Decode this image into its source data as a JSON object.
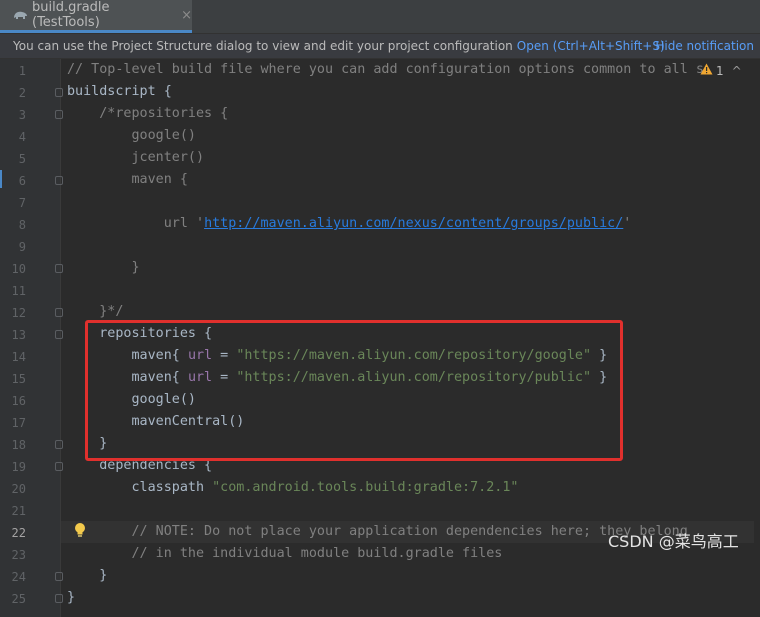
{
  "tab": {
    "icon": "gradle-elephant-icon",
    "label": "build.gradle (TestTools)",
    "close": "×"
  },
  "notification": {
    "message": "You can use the Project Structure dialog to view and edit your project configuration",
    "open_link": "Open (Ctrl+Alt+Shift+S)",
    "hide_link": "Hide notification"
  },
  "inspection": {
    "icon": "warning-icon",
    "count": "1",
    "chevron": "^"
  },
  "colors": {
    "highlight_box": "#e0302d",
    "link": "#589df6",
    "string": "#6a8759",
    "comment": "#808080",
    "property": "#9876aa"
  },
  "code": {
    "line_numbers": [
      "1",
      "2",
      "3",
      "4",
      "5",
      "6",
      "7",
      "8",
      "9",
      "10",
      "11",
      "12",
      "13",
      "14",
      "15",
      "16",
      "17",
      "18",
      "19",
      "20",
      "21",
      "22",
      "23",
      "24",
      "25"
    ],
    "current_line": "22",
    "l1": "// Top-level build file where you can add configuration options common to all s",
    "l2": "buildscript {",
    "l3": "    /*repositories {",
    "l4": "        google()",
    "l5": "        jcenter()",
    "l6": "        maven {",
    "l8_pre": "            url '",
    "l8_url": "http://maven.aliyun.com/nexus/content/groups/public/",
    "l8_post": "'",
    "l10": "        }",
    "l12": "    }*/",
    "l13": "    repositories {",
    "l14_a": "        maven{ ",
    "l14_b": "url",
    "l14_c": " = ",
    "l14_d": "\"https://maven.aliyun.com/repository/google\"",
    "l14_e": " }",
    "l15_a": "        maven{ ",
    "l15_b": "url",
    "l15_c": " = ",
    "l15_d": "\"https://maven.aliyun.com/repository/public\"",
    "l15_e": " }",
    "l16": "        google()",
    "l17": "        mavenCentral()",
    "l18": "    }",
    "l19": "    dependencies {",
    "l20_a": "        classpath ",
    "l20_b": "\"com.android.tools.build:gradle:7.2.1\"",
    "l22": "        // NOTE: Do not place your application dependencies here; they belong",
    "l23": "        // in the individual module build.gradle files",
    "l24": "    }",
    "l25": "}"
  },
  "watermark": "CSDN @菜鸟高工"
}
